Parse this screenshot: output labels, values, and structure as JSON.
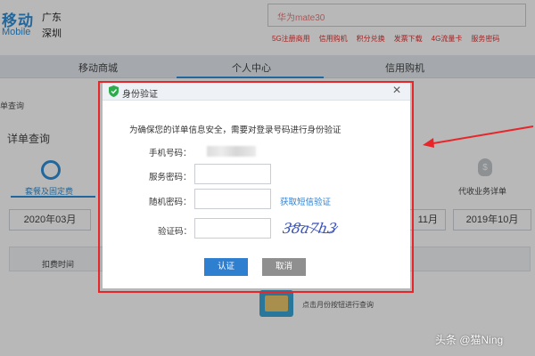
{
  "header": {
    "logo_text": "移动",
    "logo_sub": "Mobile",
    "location_province": "广东",
    "location_city": "深圳",
    "search_text": "华为mate30",
    "top_links": [
      "5G注册商用",
      "信用购机",
      "积分兑换",
      "发票下载",
      "4G流量卡",
      "服务密码"
    ]
  },
  "nav": {
    "items": [
      "移动商城",
      "个人中心",
      "信用购机"
    ]
  },
  "page": {
    "breadcrumb": "单查询",
    "section_title": "详单查询",
    "tab_active_label": "套餐及固定费",
    "tab_right_label": "代收业务详单",
    "coin_symbol": "$",
    "months_left": "2020年03月",
    "months_right_partial": "11月",
    "months_right": "2019年10月",
    "table_header": "扣费时间",
    "empty_text": "点击月份按钮进行查询"
  },
  "modal": {
    "title": "身份验证",
    "close_symbol": "×",
    "notice": "为确保您的详单信息安全，需要对登录号码进行身份验证",
    "phone_label": "手机号码：",
    "service_pwd_label": "服务密码：",
    "random_pwd_label": "随机密码：",
    "captcha_label": "验证码：",
    "sms_link": "获取短信验证",
    "captcha_text": "38a7h3",
    "confirm_label": "认证",
    "cancel_label": "取消",
    "service_pwd_value": "",
    "random_pwd_value": "",
    "captcha_value": ""
  },
  "colors": {
    "accent": "#2f7fd0",
    "highlight_border": "#e8262a",
    "cancel_gray": "#8f8f8f"
  },
  "watermark": "头条 @猫Ning"
}
